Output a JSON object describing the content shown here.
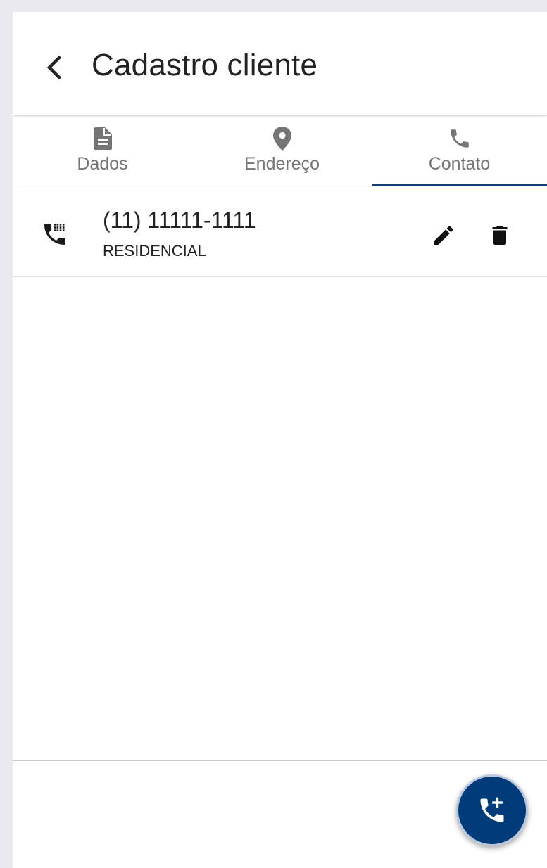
{
  "header": {
    "title": "Cadastro cliente"
  },
  "tabs": [
    {
      "label": "Dados",
      "icon": "document-icon",
      "active": false
    },
    {
      "label": "Endereço",
      "icon": "location-pin-icon",
      "active": false
    },
    {
      "label": "Contato",
      "icon": "phone-icon",
      "active": true
    }
  ],
  "contacts": [
    {
      "number": "(11) 11111-1111",
      "type": "RESIDENCIAL",
      "icon": "landline-phone-icon"
    }
  ],
  "actions": {
    "edit_icon": "pencil-icon",
    "delete_icon": "trash-icon",
    "fab_icon": "add-phone-icon"
  },
  "colors": {
    "accent": "#143c78",
    "fab": "#003b7a",
    "text": "#222222",
    "tab_text": "#757575",
    "background": "#e9e9ef"
  }
}
